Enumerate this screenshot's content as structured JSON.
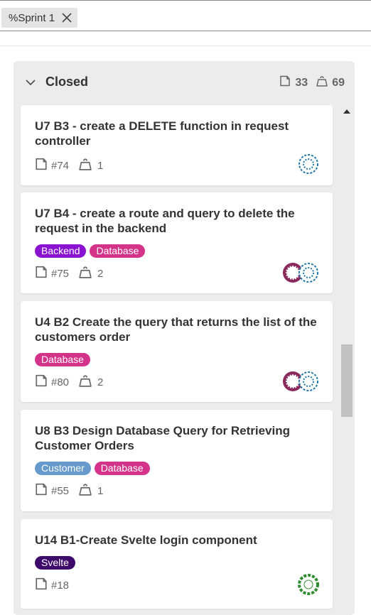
{
  "filter": {
    "label": "%Sprint 1"
  },
  "column": {
    "title": "Closed",
    "issue_count": "33",
    "weight_total": "69"
  },
  "cards": [
    {
      "title": "U7 B3 - create a DELETE function in request controller",
      "number": "#74",
      "weight": "1",
      "labels": [],
      "avatars": [
        "blue"
      ]
    },
    {
      "title": "U7 B4 - create a route and query to delete the request in the backend",
      "number": "#75",
      "weight": "2",
      "labels": [
        {
          "text": "Backend",
          "color": "#8a12d1"
        },
        {
          "text": "Database",
          "color": "#d4338a"
        }
      ],
      "avatars": [
        "magenta",
        "blue"
      ]
    },
    {
      "title": "U4 B2 Create the query that returns the list of the customers order",
      "number": "#80",
      "weight": "2",
      "labels": [
        {
          "text": "Database",
          "color": "#d4338a"
        }
      ],
      "avatars": [
        "magenta",
        "blue"
      ]
    },
    {
      "title": "U8 B3 Design Database Query for Retrieving Customer Orders",
      "number": "#55",
      "weight": "1",
      "labels": [
        {
          "text": "Customer",
          "color": "#6699cc"
        },
        {
          "text": "Database",
          "color": "#d4338a"
        }
      ],
      "avatars": []
    },
    {
      "title": "U14 B1-Create Svelte login component",
      "number": "#18",
      "weight": "",
      "labels": [
        {
          "text": "Svelte",
          "color": "#3d0a6b"
        }
      ],
      "avatars": [
        "green"
      ]
    }
  ],
  "icons": {
    "chip_close": "close-icon",
    "collapse": "chevron-down-icon",
    "issues": "issue-icon",
    "weight": "weight-icon"
  },
  "avatar_colors": {
    "blue": "#1f78a8",
    "magenta": "#8a2a5c",
    "green": "#2e8b2e"
  }
}
